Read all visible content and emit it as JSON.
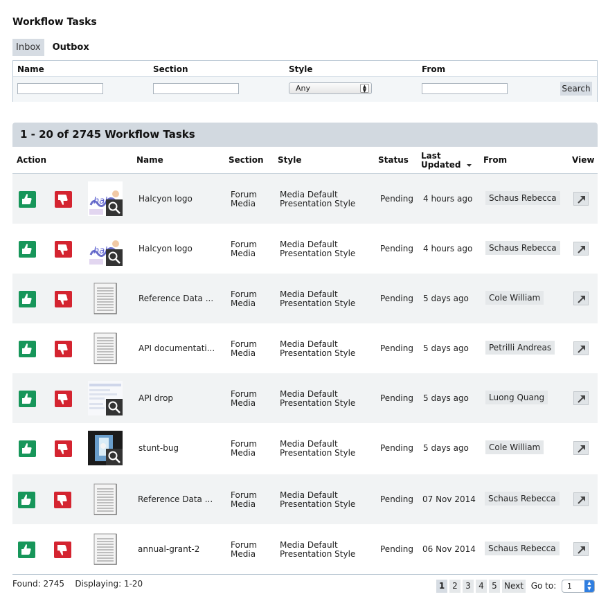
{
  "page": {
    "title": "Workflow Tasks"
  },
  "tabs": [
    {
      "label": "Inbox",
      "active": true
    },
    {
      "label": "Outbox",
      "active": false
    }
  ],
  "filters": {
    "name_label": "Name",
    "section_label": "Section",
    "style_label": "Style",
    "from_label": "From",
    "name_value": "",
    "section_value": "",
    "style_selected": "Any",
    "from_value": "",
    "search_label": "Search"
  },
  "results": {
    "summary": "1 - 20 of 2745 Workflow Tasks"
  },
  "columns": {
    "action": "Action",
    "name": "Name",
    "section": "Section",
    "style": "Style",
    "status": "Status",
    "last_updated_1": "Last",
    "last_updated_2": "Updated",
    "from": "From",
    "view": "View"
  },
  "rows": [
    {
      "thumb": "image-halcyon",
      "name": "Halcyon logo",
      "section_1": "Forum",
      "section_2": "Media",
      "style_1": "Media Default",
      "style_2": "Presentation Style",
      "status": "Pending",
      "updated": "4 hours ago",
      "from": "Schaus Rebecca"
    },
    {
      "thumb": "image-halcyon",
      "name": "Halcyon logo",
      "section_1": "Forum",
      "section_2": "Media",
      "style_1": "Media Default",
      "style_2": "Presentation Style",
      "status": "Pending",
      "updated": "4 hours ago",
      "from": "Schaus Rebecca"
    },
    {
      "thumb": "document",
      "name": "Reference Data ...",
      "section_1": "Forum",
      "section_2": "Media",
      "style_1": "Media Default",
      "style_2": "Presentation Style",
      "status": "Pending",
      "updated": "5 days ago",
      "from": "Cole William"
    },
    {
      "thumb": "document",
      "name": "API documentati...",
      "section_1": "Forum",
      "section_2": "Media",
      "style_1": "Media Default",
      "style_2": "Presentation Style",
      "status": "Pending",
      "updated": "5 days ago",
      "from": "Petrilli Andreas"
    },
    {
      "thumb": "image-screenshot",
      "name": "API drop",
      "section_1": "Forum",
      "section_2": "Media",
      "style_1": "Media Default",
      "style_2": "Presentation Style",
      "status": "Pending",
      "updated": "5 days ago",
      "from": "Luong Quang"
    },
    {
      "thumb": "image-bug",
      "name": "stunt-bug",
      "section_1": "Forum",
      "section_2": "Media",
      "style_1": "Media Default",
      "style_2": "Presentation Style",
      "status": "Pending",
      "updated": "5 days ago",
      "from": "Cole William"
    },
    {
      "thumb": "document",
      "name": "Reference Data ...",
      "section_1": "Forum",
      "section_2": "Media",
      "style_1": "Media Default",
      "style_2": "Presentation Style",
      "status": "Pending",
      "updated": "07 Nov 2014",
      "from": "Schaus Rebecca"
    },
    {
      "thumb": "document",
      "name": "annual-grant-2",
      "section_1": "Forum",
      "section_2": "Media",
      "style_1": "Media Default",
      "style_2": "Presentation Style",
      "status": "Pending",
      "updated": "06 Nov 2014",
      "from": "Schaus Rebecca"
    }
  ],
  "footer": {
    "found": "Found: 2745",
    "displaying": "Displaying: 1-20",
    "pages": [
      "1",
      "2",
      "3",
      "4",
      "5"
    ],
    "current_page": "1",
    "next_label": "Next",
    "goto_label": "Go to:",
    "goto_value": "1"
  },
  "colors": {
    "approve": "#17965a",
    "reject": "#d42430",
    "header_bar": "#d2d9e0",
    "row_alt": "#f1f3f4"
  }
}
